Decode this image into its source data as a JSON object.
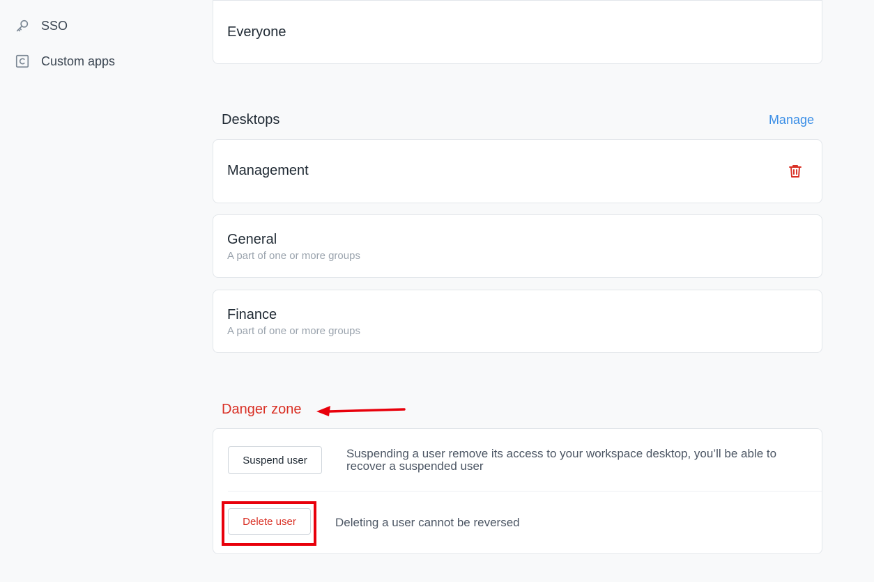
{
  "sidebar": {
    "items": [
      {
        "label": "SSO",
        "icon": "key-icon"
      },
      {
        "label": "Custom apps",
        "icon": "custom-apps-icon"
      }
    ]
  },
  "groups_card": {
    "title": "Everyone"
  },
  "desktops": {
    "title": "Desktops",
    "manage_label": "Manage",
    "items": [
      {
        "title": "Management",
        "subtitle": ""
      },
      {
        "title": "General",
        "subtitle": "A part of one or more groups"
      },
      {
        "title": "Finance",
        "subtitle": "A part of one or more groups"
      }
    ]
  },
  "danger_zone": {
    "title": "Danger zone",
    "suspend_label": "Suspend user",
    "suspend_desc": "Suspending a user remove its access to your workspace desktop, you’ll be able to recover a suspended user",
    "delete_label": "Delete user",
    "delete_desc": "Deleting a user cannot be reversed"
  },
  "colors": {
    "danger": "#d93025",
    "link": "#3a8ee6",
    "annotation": "#e8000b"
  }
}
